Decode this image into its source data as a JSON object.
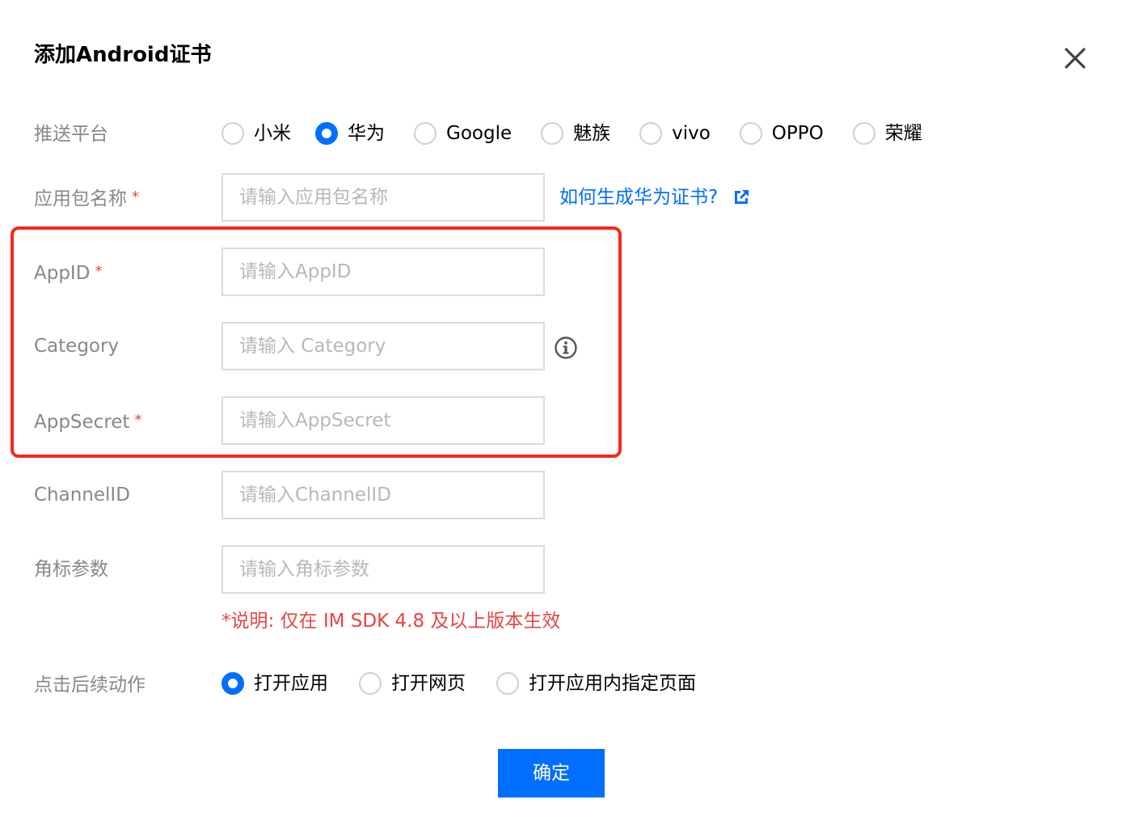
{
  "dialog": {
    "title": "添加Android证书"
  },
  "icons": {
    "close": "close-icon",
    "external_link": "external-link-icon",
    "info": "info-icon"
  },
  "colors": {
    "accent": "#006eff",
    "required": "#e54545",
    "highlight_border": "#f5291c",
    "label": "#888888",
    "placeholder": "#b8b8b8"
  },
  "platform": {
    "label": "推送平台",
    "selected": "华为",
    "options": [
      {
        "label": "小米",
        "checked": false
      },
      {
        "label": "华为",
        "checked": true
      },
      {
        "label": "Google",
        "checked": false
      },
      {
        "label": "魅族",
        "checked": false
      },
      {
        "label": "vivo",
        "checked": false
      },
      {
        "label": "OPPO",
        "checked": false
      },
      {
        "label": "荣耀",
        "checked": false
      }
    ]
  },
  "package_name": {
    "label": "应用包名称",
    "required_mark": "*",
    "placeholder": "请输入应用包名称",
    "value": "",
    "help_link": "如何生成华为证书?"
  },
  "app_id": {
    "label": "AppID",
    "required_mark": "*",
    "placeholder": "请输入AppID",
    "value": ""
  },
  "category": {
    "label": "Category",
    "placeholder": "请输入 Category",
    "value": ""
  },
  "app_secret": {
    "label": "AppSecret",
    "required_mark": "*",
    "placeholder": "请输入AppSecret",
    "value": ""
  },
  "channel_id": {
    "label": "ChannelID",
    "placeholder": "请输入ChannelID",
    "value": ""
  },
  "badge_param": {
    "label": "角标参数",
    "placeholder": "请输入角标参数",
    "value": "",
    "note": "*说明: 仅在 IM SDK 4.8 及以上版本生效"
  },
  "click_action": {
    "label": "点击后续动作",
    "selected": "打开应用",
    "options": [
      {
        "label": "打开应用",
        "checked": true
      },
      {
        "label": "打开网页",
        "checked": false
      },
      {
        "label": "打开应用内指定页面",
        "checked": false
      }
    ]
  },
  "confirm": {
    "label": "确定"
  }
}
